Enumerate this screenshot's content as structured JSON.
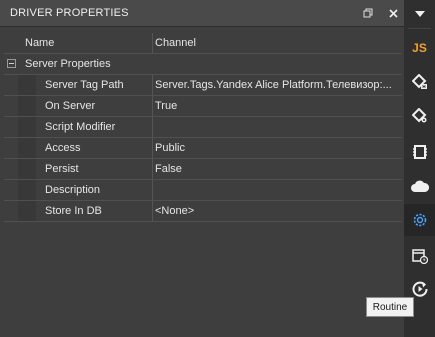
{
  "panel": {
    "title": "DRIVER PROPERTIES"
  },
  "grid": {
    "header": {
      "name": "Name",
      "value": "Channel"
    },
    "category": "Server Properties",
    "properties": [
      {
        "name": "Server Tag Path",
        "value": "Server.Tags.Yandex Alice Platform.Телевизор:..."
      },
      {
        "name": "On Server",
        "value": "True"
      },
      {
        "name": "Script Modifier",
        "value": ""
      },
      {
        "name": "Access",
        "value": "Public"
      },
      {
        "name": "Persist",
        "value": "False"
      },
      {
        "name": "Description",
        "value": ""
      },
      {
        "name": "Store In DB",
        "value": "<None>"
      }
    ]
  },
  "rightbar": {
    "js_label": "JS",
    "accent": "#f0a030",
    "selected_color": "#4aa3ff"
  },
  "tooltip": "Routine"
}
